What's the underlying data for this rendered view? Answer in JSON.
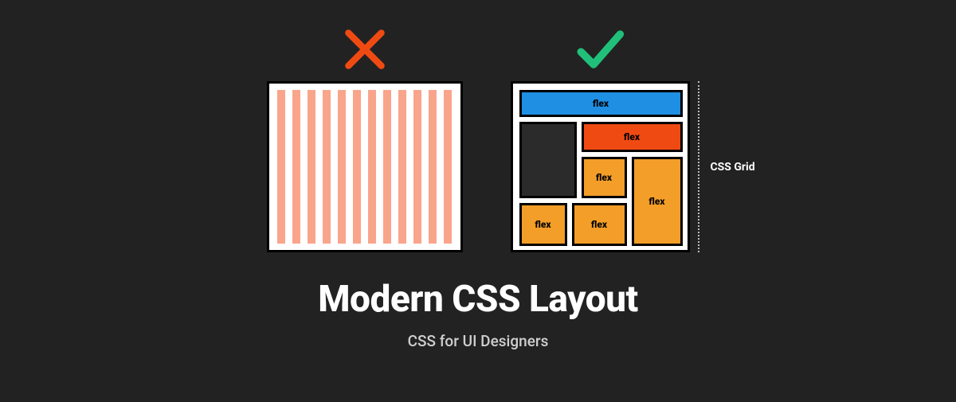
{
  "title": "Modern CSS Layout",
  "subtitle": "CSS for UI Designers",
  "annotation": "CSS Grid",
  "cells": {
    "top": "flex",
    "row2": "flex",
    "midL": "flex",
    "midR": "flex",
    "botL": "flex",
    "botM": "flex"
  },
  "colors": {
    "bg": "#222222",
    "cross": "#f04a13",
    "check": "#20c07a",
    "stripe": "#f9a58b",
    "blue": "#1f8fe3",
    "orange": "#f04a13",
    "amber": "#f29e28"
  }
}
